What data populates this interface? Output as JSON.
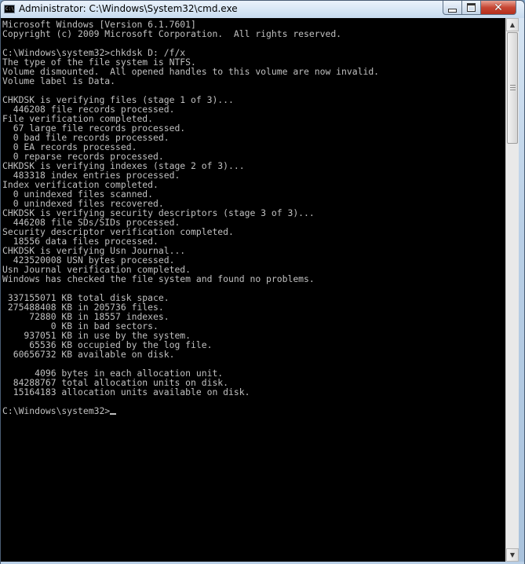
{
  "window": {
    "title": "Administrator: C:\\Windows\\System32\\cmd.exe",
    "icon_label": "C:\\",
    "controls": {
      "minimize": "minimize-icon",
      "maximize": "maximize-icon",
      "close": "close-icon"
    },
    "close_glyph": "✕"
  },
  "console": {
    "text_color": "#c0c0c0",
    "background": "#000000",
    "lines": [
      "Microsoft Windows [Version 6.1.7601]",
      "Copyright (c) 2009 Microsoft Corporation.  All rights reserved.",
      "",
      "C:\\Windows\\system32>chkdsk D: /f/x",
      "The type of the file system is NTFS.",
      "Volume dismounted.  All opened handles to this volume are now invalid.",
      "Volume label is Data.",
      "",
      "CHKDSK is verifying files (stage 1 of 3)...",
      "  446208 file records processed.",
      "File verification completed.",
      "  67 large file records processed.",
      "  0 bad file records processed.",
      "  0 EA records processed.",
      "  0 reparse records processed.",
      "CHKDSK is verifying indexes (stage 2 of 3)...",
      "  483318 index entries processed.",
      "Index verification completed.",
      "  0 unindexed files scanned.",
      "  0 unindexed files recovered.",
      "CHKDSK is verifying security descriptors (stage 3 of 3)...",
      "  446208 file SDs/SIDs processed.",
      "Security descriptor verification completed.",
      "  18556 data files processed.",
      "CHKDSK is verifying Usn Journal...",
      "  423520008 USN bytes processed.",
      "Usn Journal verification completed.",
      "Windows has checked the file system and found no problems.",
      "",
      " 337155071 KB total disk space.",
      " 275488408 KB in 205736 files.",
      "     72880 KB in 18557 indexes.",
      "         0 KB in bad sectors.",
      "    937051 KB in use by the system.",
      "     65536 KB occupied by the log file.",
      "  60656732 KB available on disk.",
      "",
      "      4096 bytes in each allocation unit.",
      "  84288767 total allocation units on disk.",
      "  15164183 allocation units available on disk.",
      ""
    ],
    "prompt": "C:\\Windows\\system32>"
  },
  "scrollbar": {
    "up_arrow": "▲",
    "down_arrow": "▼"
  }
}
